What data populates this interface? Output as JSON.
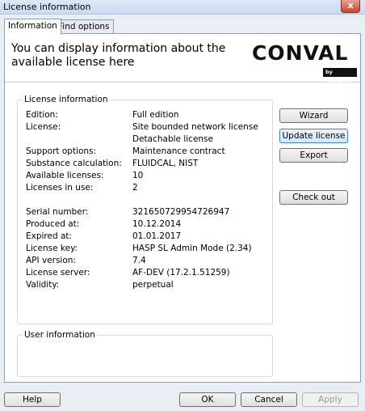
{
  "window": {
    "title": "License information",
    "close_glyph": "x"
  },
  "tabs": [
    {
      "label": "Information",
      "active": true
    },
    {
      "label": "Find options",
      "active": false
    }
  ],
  "header": {
    "text": "You can display information about the available license here",
    "logo_word": "CONVAL",
    "logo_tag": "by F.I.R.S.T."
  },
  "license_info": {
    "title": "License information",
    "rows": [
      {
        "key": "Edition:",
        "value": "Full edition"
      },
      {
        "key": "License:",
        "value": "Site bounded network license"
      },
      {
        "key": "",
        "value": "Detachable license"
      },
      {
        "key": "Support options:",
        "value": "Maintenance contract"
      },
      {
        "key": "Substance calculation:",
        "value": "FLUIDCAL, NIST"
      },
      {
        "key": "Available licenses:",
        "value": "10"
      },
      {
        "key": "Licenses in use:",
        "value": "2"
      },
      {
        "key": "Serial number:",
        "value": "321650729954726947"
      },
      {
        "key": "Produced at:",
        "value": "10.12.2014"
      },
      {
        "key": "Expired at:",
        "value": "01.01.2017"
      },
      {
        "key": "License key:",
        "value": "HASP SL Admin Mode (2.34)"
      },
      {
        "key": "API version:",
        "value": "7.4"
      },
      {
        "key": "License server:",
        "value": "AF-DEV (17.2.1.51259)"
      },
      {
        "key": "Validity:",
        "value": "perpetual"
      }
    ]
  },
  "user_info": {
    "title": "User information"
  },
  "side_buttons": {
    "wizard": "Wizard",
    "update_license": "Update license",
    "export": "Export",
    "check_out": "Check out"
  },
  "footer": {
    "help": "Help",
    "ok": "OK",
    "cancel": "Cancel",
    "apply": "Apply"
  },
  "colors": {
    "logo": "#111111",
    "focus_border": "#3c7fb1",
    "close_button": "#c7452f"
  }
}
